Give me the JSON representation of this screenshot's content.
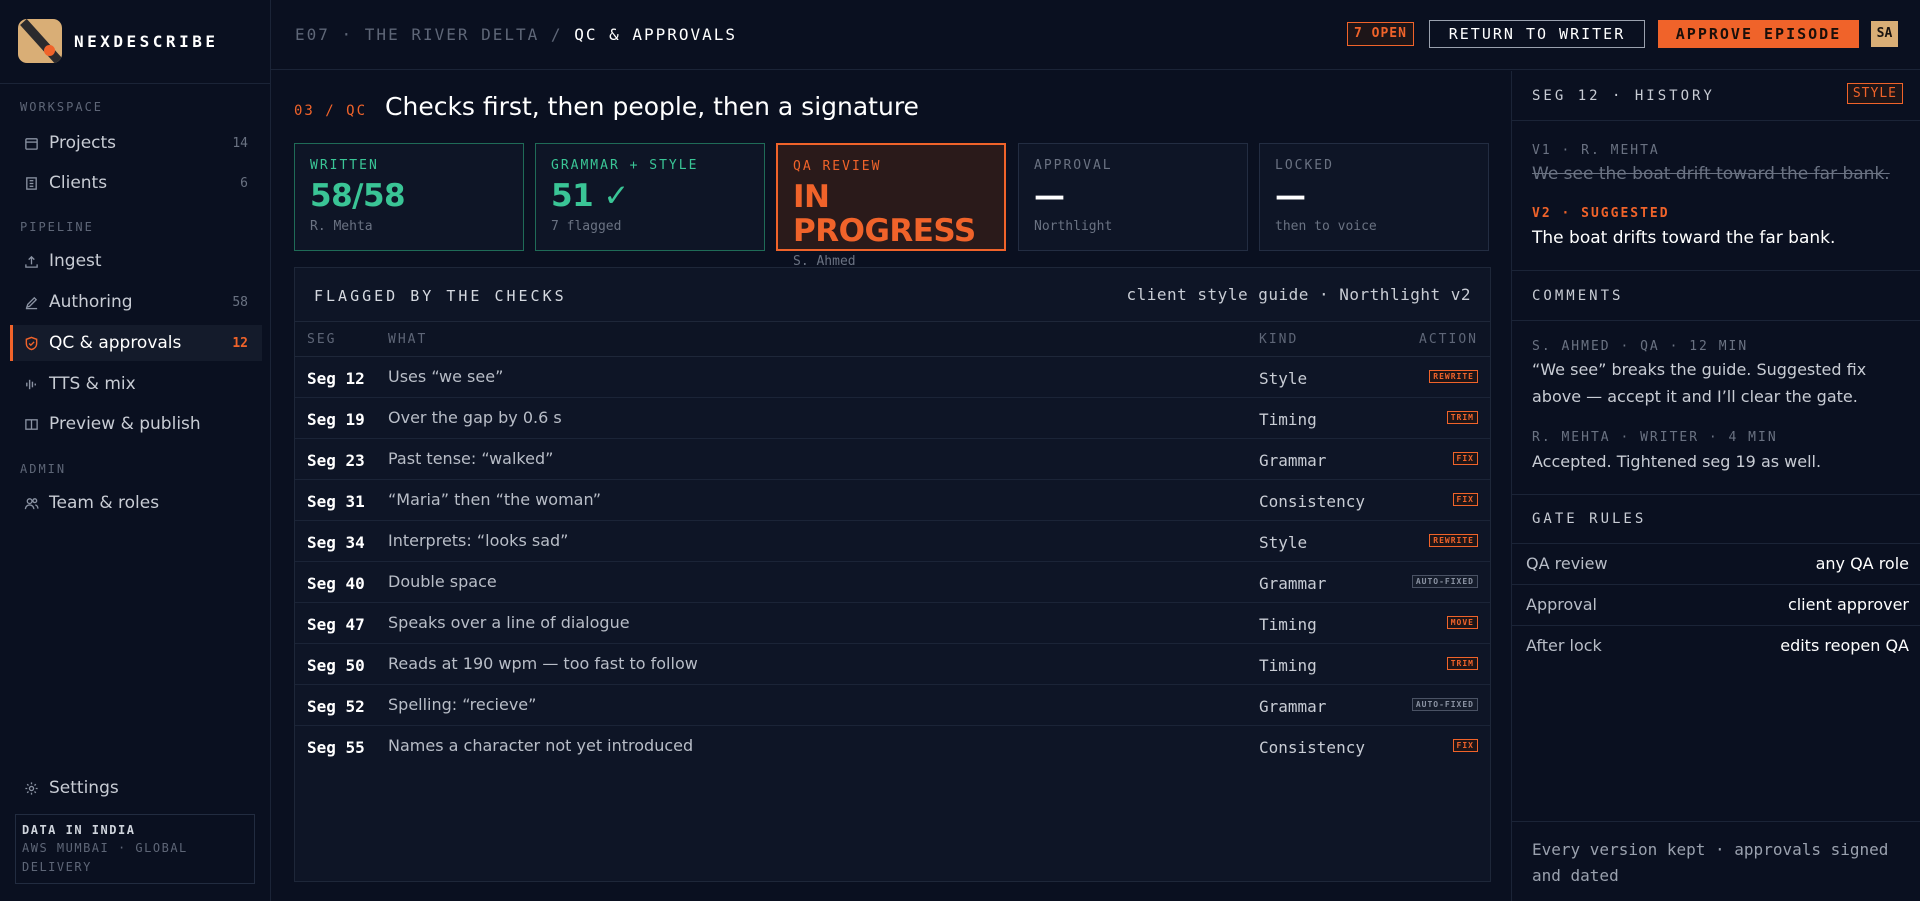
{
  "app": {
    "name": "NEXDESCRIBE"
  },
  "sidebar": {
    "sections": [
      "WORKSPACE",
      "PIPELINE",
      "ADMIN"
    ],
    "items": [
      {
        "label": "Projects",
        "icon": "calendar-icon",
        "count": "14"
      },
      {
        "label": "Clients",
        "icon": "building-icon",
        "count": "6"
      },
      {
        "label": "Ingest",
        "icon": "upload-icon",
        "count": ""
      },
      {
        "label": "Authoring",
        "icon": "pencil-icon",
        "count": "58"
      },
      {
        "label": "QC & approvals",
        "icon": "shield-check-icon",
        "count": "12"
      },
      {
        "label": "TTS & mix",
        "icon": "waveform-icon",
        "count": ""
      },
      {
        "label": "Preview & publish",
        "icon": "book-icon",
        "count": ""
      },
      {
        "label": "Team & roles",
        "icon": "users-icon",
        "count": ""
      }
    ],
    "settings": "Settings",
    "region": {
      "title": "DATA IN INDIA",
      "line1": "AWS MUMBAI · GLOBAL",
      "line2": "DELIVERY"
    }
  },
  "topbar": {
    "crumb_prefix": "E07 · THE RIVER DELTA / ",
    "crumb_current": "QC & APPROVALS",
    "open_badge": "7 OPEN",
    "return_label": "RETURN TO WRITER",
    "approve_label": "APPROVE EPISODE",
    "avatar": "SA"
  },
  "main": {
    "step": "03 / QC",
    "title": "Checks first, then people, then a signature",
    "cards": [
      {
        "label": "WRITTEN",
        "value": "58/58",
        "sub": "R. Mehta"
      },
      {
        "label": "GRAMMAR + STYLE",
        "value": "51 ✓",
        "sub": "7 flagged"
      },
      {
        "label": "QA REVIEW",
        "value": "IN PROGRESS",
        "sub": "S. Ahmed"
      },
      {
        "label": "APPROVAL",
        "value": "—",
        "sub": "Northlight"
      },
      {
        "label": "LOCKED",
        "value": "—",
        "sub": "then to voice"
      }
    ],
    "table": {
      "title": "FLAGGED BY THE CHECKS",
      "meta": "client style guide · Northlight v2",
      "columns": [
        "SEG",
        "WHAT",
        "KIND",
        "ACTION"
      ],
      "rows": [
        {
          "seg": "Seg 12",
          "what": "Uses “we see”",
          "kind": "Style",
          "action": "REWRITE"
        },
        {
          "seg": "Seg 19",
          "what": "Over the gap by 0.6 s",
          "kind": "Timing",
          "action": "TRIM"
        },
        {
          "seg": "Seg 23",
          "what": "Past tense: “walked”",
          "kind": "Grammar",
          "action": "FIX"
        },
        {
          "seg": "Seg 31",
          "what": "“Maria” then “the woman”",
          "kind": "Consistency",
          "action": "FIX"
        },
        {
          "seg": "Seg 34",
          "what": "Interprets: “looks sad”",
          "kind": "Style",
          "action": "REWRITE"
        },
        {
          "seg": "Seg 40",
          "what": "Double space",
          "kind": "Grammar",
          "action": "AUTO-FIXED"
        },
        {
          "seg": "Seg 47",
          "what": "Speaks over a line of dialogue",
          "kind": "Timing",
          "action": "MOVE"
        },
        {
          "seg": "Seg 50",
          "what": "Reads at 190 wpm — too fast to follow",
          "kind": "Timing",
          "action": "TRIM"
        },
        {
          "seg": "Seg 52",
          "what": "Spelling: “recieve”",
          "kind": "Grammar",
          "action": "AUTO-FIXED"
        },
        {
          "seg": "Seg 55",
          "what": "Names a character not yet introduced",
          "kind": "Consistency",
          "action": "FIX"
        }
      ]
    }
  },
  "right": {
    "history_title": "SEG 12 · HISTORY",
    "history_badge": "STYLE",
    "v1_label": "V1 · R. MEHTA",
    "v1_text": "We see the boat drift toward the far bank.",
    "v2_label": "V2 · SUGGESTED",
    "v2_text": "The boat drifts toward the far bank.",
    "comments_title": "COMMENTS",
    "comments": [
      {
        "meta": "S. AHMED · QA · 12 MIN",
        "text": "“We see” breaks the guide. Suggested fix above — accept it and I’ll clear the gate."
      },
      {
        "meta": "R. MEHTA · WRITER · 4 MIN",
        "text": "Accepted. Tightened seg 19 as well."
      }
    ],
    "rules_title": "GATE RULES",
    "rules": [
      {
        "k": "QA review",
        "v": "any QA role"
      },
      {
        "k": "Approval",
        "v": "client approver"
      },
      {
        "k": "After lock",
        "v": "edits reopen QA"
      }
    ],
    "footnote": "Every version kept · approvals signed and dated"
  }
}
